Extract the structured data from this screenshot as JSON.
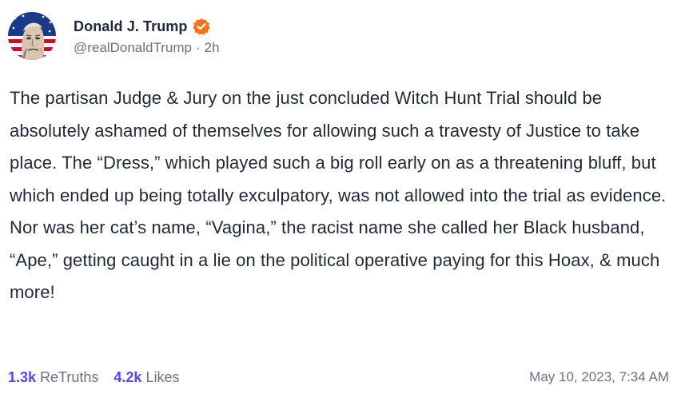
{
  "author": {
    "display_name": "Donald J. Trump",
    "handle": "@realDonaldTrump",
    "separator": "·",
    "relative_time": "2h",
    "verified_badge_color": "#f97316",
    "avatar_icon": "flag-portrait-avatar",
    "verified_icon": "verified-check-icon"
  },
  "post": {
    "text": "The partisan Judge & Jury on the just concluded Witch Hunt Trial should be absolutely ashamed of themselves for allowing such a travesty of Justice to take place. The “Dress,” which played such a big roll early on as a threatening bluff, but which ended up being totally exculpatory, was not allowed into the trial as evidence. Nor was her cat’s name, “Vagina,” the racist name she called her Black husband, “Ape,” getting caught in a lie on the political operative paying for this Hoax, & much more!"
  },
  "stats": {
    "retruths_count": "1.3k",
    "retruths_label": "ReTruths",
    "likes_count": "4.2k",
    "likes_label": "Likes",
    "accent_color": "#5448ee"
  },
  "timestamp": "May 10, 2023, 7:34 AM"
}
